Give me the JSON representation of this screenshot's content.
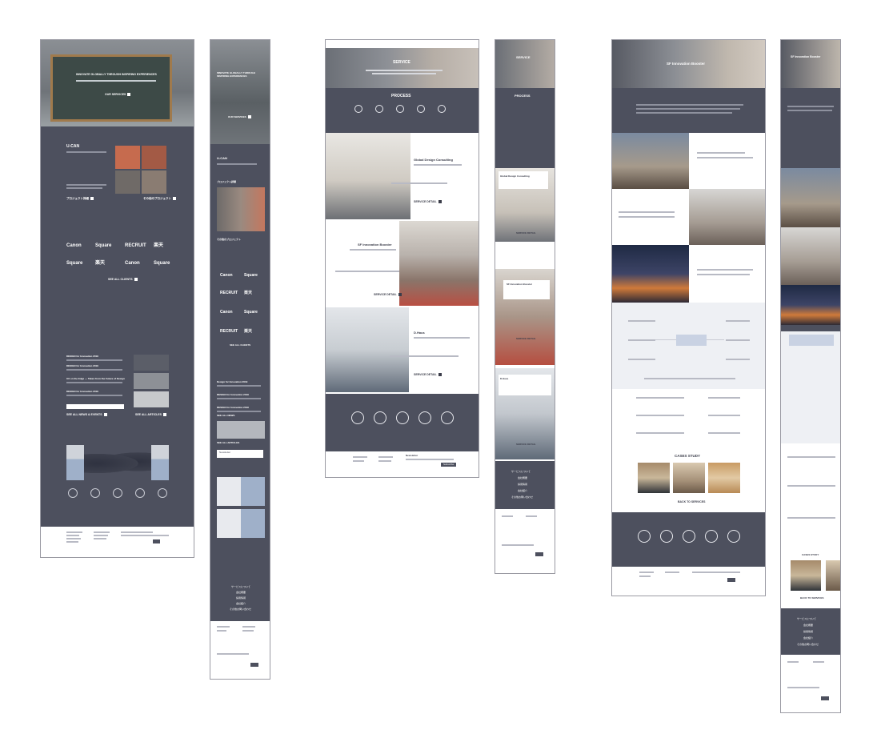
{
  "home": {
    "hero_title": "INNOVATE GLOBALLY THROUGH INSPIRING EXPERIENCES",
    "hero_button": "OUR SERVICES",
    "section_title": "U-CAN",
    "project_link": "プロジェクト詳細",
    "all_projects": "その他のプロジェクト",
    "clients": [
      "Canon",
      "Square",
      "RECRUIT",
      "楽天",
      "Square",
      "楽天",
      "Canon",
      "Square"
    ],
    "see_all_clients": "SEE ALL CLIENTS",
    "news": [
      "DESIGN for Innovation 2019",
      "DESIGN for Innovation 2019",
      "UX on the Edge — Taken from the Future of Design",
      "DESIGN for Innovation 2019"
    ],
    "see_all_news": "SEE ALL NEWS & EVENTS",
    "see_all_articles": "SEE ALL ARTICLES"
  },
  "mobile_home": {
    "hero_title": "INNOVATE GLOBALLY THROUGH INSPIRING EXPERIENCES",
    "hero_button": "OUR SERVICES",
    "section_title": "U-CAN",
    "project_link": "プロジェクト詳細",
    "all_projects": "その他のプロジェクト",
    "clients": [
      "Canon",
      "Square",
      "RECRUIT",
      "楽天",
      "Canon",
      "Square",
      "RECRUIT",
      "楽天"
    ],
    "see_all_clients": "SEE ALL CLIENTS",
    "news": [
      "Design for Innovation 2019",
      "DESIGN for Innovation 2019",
      "DESIGN for Innovation 2019"
    ],
    "see_all_news": "SEE ALL NEWS",
    "see_all_articles": "SEE ALL ARTICLES",
    "newsletter": "Newsletter",
    "menu_items": [
      "サービスについて",
      "会社概要",
      "採用情報",
      "会社紹介",
      "その他お問い合わせ"
    ]
  },
  "service": {
    "hero_title": "SERVICE",
    "process_title": "PROCESS",
    "blocks": [
      {
        "title": "Global Design Consulting",
        "detail": "SERVICE DETAIL"
      },
      {
        "title": "SF Innovation Booster",
        "detail": "SERVICE DETAIL"
      },
      {
        "title": "D.Haus",
        "detail": "SERVICE DETAIL"
      }
    ],
    "newsletter": "Newsletter",
    "subscribe": "Subscribe"
  },
  "mobile_service": {
    "hero_title": "SERVICE",
    "process_title": "PROCESS",
    "blocks": [
      {
        "title": "Global Design Consulting",
        "detail": "SERVICE DETAIL"
      },
      {
        "title": "SF Innovation Booster",
        "detail": "SERVICE DETAIL"
      },
      {
        "title": "D.Haus",
        "detail": "SERVICE DETAIL"
      }
    ],
    "menu_items": [
      "サービスについて",
      "会社概要",
      "採用情報",
      "会社紹介",
      "その他お問い合わせ"
    ]
  },
  "booster": {
    "hero_title": "SF Innovation Booster",
    "cases_title": "CASES STUDY",
    "back_link": "BACK TO SERVICES"
  },
  "mobile_booster": {
    "hero_title": "SF Innovation Booster",
    "cases_title": "CASES STUDY",
    "back_link": "BACK TO SERVICES",
    "menu_items": [
      "サービスについて",
      "会社概要",
      "採用情報",
      "会社紹介",
      "その他お問い合わせ"
    ]
  },
  "colors": {
    "dark": "#4d505e",
    "light": "#ffffff",
    "accent": "#c9d2e3"
  }
}
